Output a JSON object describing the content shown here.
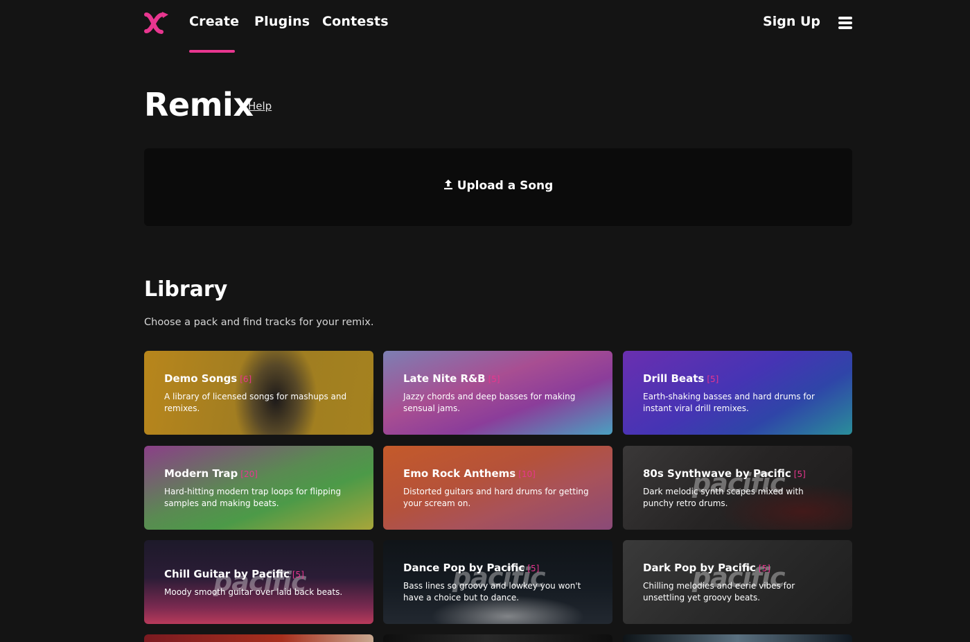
{
  "nav": {
    "links": [
      "Create",
      "Plugins",
      "Contests"
    ],
    "signup": "Sign Up",
    "accent": "#e8368f"
  },
  "page": {
    "title": "Remix",
    "help": "Help"
  },
  "upload": {
    "label": "Upload a Song",
    "icon": "upload-icon"
  },
  "library": {
    "title": "Library",
    "subtitle": "Choose a pack and find tracks for your remix.",
    "cards": [
      {
        "title": "Demo Songs",
        "count": "[6]",
        "desc": "A library of licensed songs for mashups and remixes."
      },
      {
        "title": "Late Nite R&B",
        "count": "[5]",
        "desc": "Jazzy chords and deep basses for making sensual jams."
      },
      {
        "title": "Drill Beats",
        "count": "[5]",
        "desc": "Earth-shaking basses and hard drums for instant viral drill remixes."
      },
      {
        "title": "Modern Trap",
        "count": "[20]",
        "desc": "Hard-hitting modern trap loops for flipping samples and making beats."
      },
      {
        "title": "Emo Rock Anthems",
        "count": "[10]",
        "desc": "Distorted guitars and hard drums for getting your scream on."
      },
      {
        "title": "80s Synthwave by Pacific",
        "count": "[5]",
        "desc": "Dark melodic synth scapes mixed with punchy retro drums.",
        "watermark": "pacific"
      },
      {
        "title": "Chill Guitar by Pacific",
        "count": "[5]",
        "desc": "Moody smooth guitar over laid back beats.",
        "watermark": "pacific"
      },
      {
        "title": "Dance Pop by Pacific",
        "count": "[5]",
        "desc": "Bass lines so groovy and lowkey you won't have a choice but to dance.",
        "watermark": "pacific"
      },
      {
        "title": "Dark Pop by Pacific",
        "count": "[5]",
        "desc": "Chilling melodies and eerie vibes for unsettling yet groovy beats.",
        "watermark": "pacific"
      }
    ]
  }
}
